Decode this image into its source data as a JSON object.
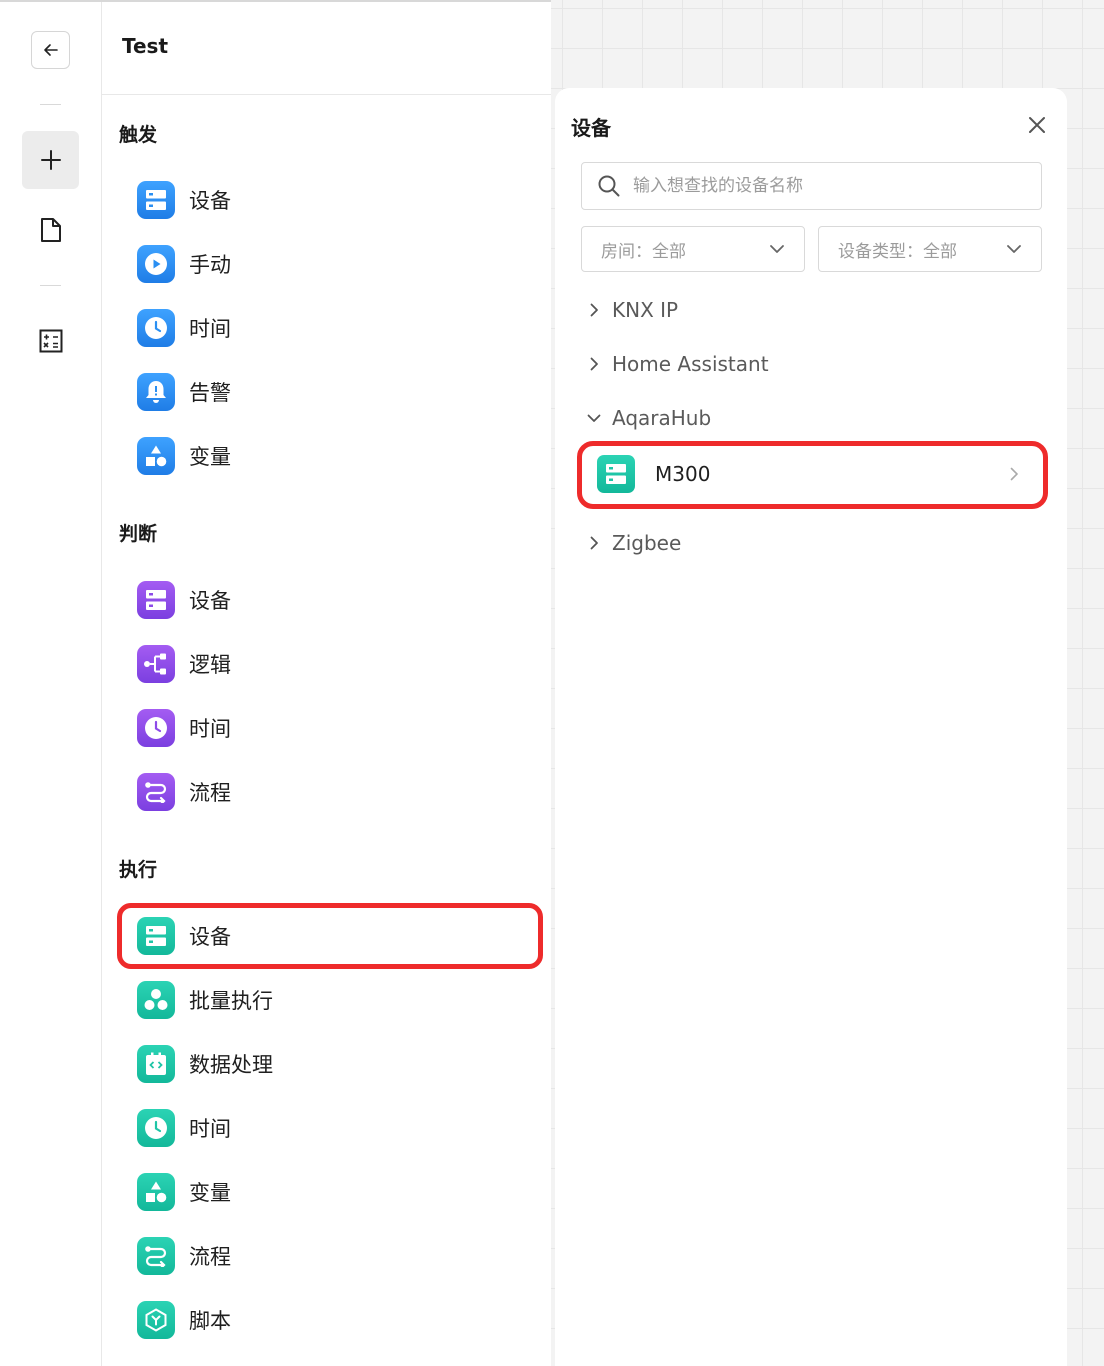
{
  "toolbar": {
    "back_icon": "arrow-left-icon",
    "add_icon": "plus-icon",
    "file_icon": "document-icon",
    "calc_icon": "calculator-icon"
  },
  "nodes": {
    "title": "Test",
    "sections": {
      "trigger": {
        "title": "触发",
        "items": [
          {
            "label": "设备",
            "icon": "device-icon"
          },
          {
            "label": "手动",
            "icon": "play-icon"
          },
          {
            "label": "时间",
            "icon": "clock-icon"
          },
          {
            "label": "告警",
            "icon": "bell-icon"
          },
          {
            "label": "变量",
            "icon": "shapes-icon"
          }
        ]
      },
      "condition": {
        "title": "判断",
        "items": [
          {
            "label": "设备",
            "icon": "device-icon"
          },
          {
            "label": "逻辑",
            "icon": "branch-icon"
          },
          {
            "label": "时间",
            "icon": "clock-icon"
          },
          {
            "label": "流程",
            "icon": "flow-icon"
          }
        ]
      },
      "action": {
        "title": "执行",
        "items": [
          {
            "label": "设备",
            "icon": "device-icon"
          },
          {
            "label": "批量执行",
            "icon": "batch-icon"
          },
          {
            "label": "数据处理",
            "icon": "code-icon"
          },
          {
            "label": "时间",
            "icon": "clock-icon"
          },
          {
            "label": "变量",
            "icon": "shapes-icon"
          },
          {
            "label": "流程",
            "icon": "flow-icon"
          },
          {
            "label": "脚本",
            "icon": "script-icon"
          }
        ]
      }
    }
  },
  "drawer": {
    "title": "设备",
    "search_placeholder": "输入想查找的设备名称",
    "room_select": "房间：全部",
    "type_select": "设备类型：全部",
    "groups": [
      {
        "label": "KNX IP",
        "expanded": false
      },
      {
        "label": "Home Assistant",
        "expanded": false
      },
      {
        "label": "AqaraHub",
        "expanded": true
      },
      {
        "label": "Zigbee",
        "expanded": false
      }
    ],
    "device": {
      "label": "M300",
      "icon": "device-icon"
    }
  },
  "colors": {
    "trigger": "#2a8ff2",
    "condition": "#8d4ae8",
    "action": "#1ec5a6",
    "highlight": "#ee2b2b"
  }
}
